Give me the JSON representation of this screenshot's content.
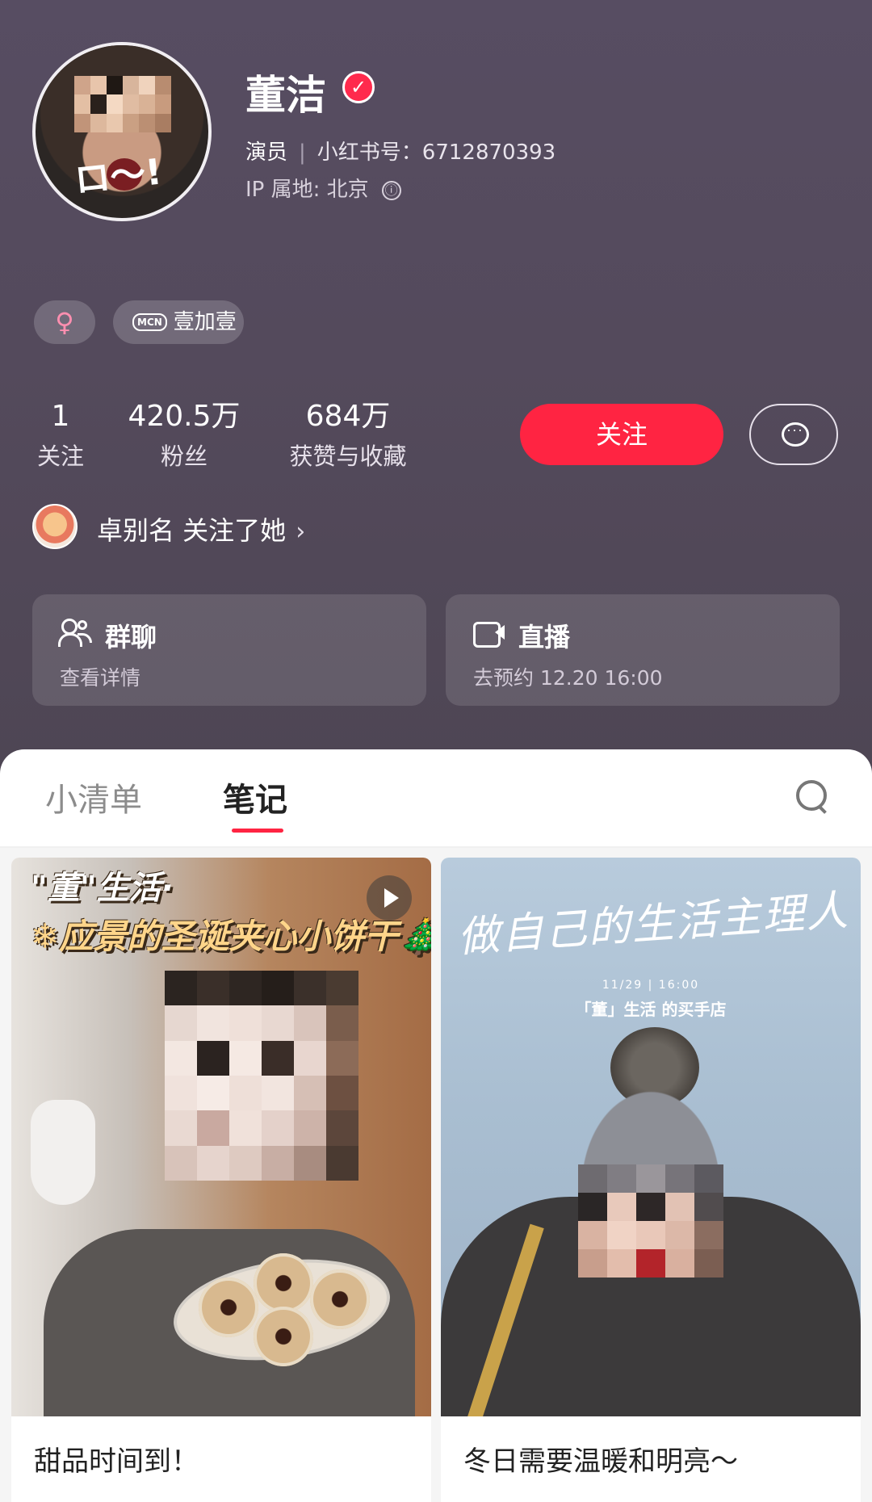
{
  "profile": {
    "name": "董洁",
    "verified_mark": "✓",
    "role": "演员",
    "separator": "|",
    "id_label": "小红书号：",
    "id_value": "6712870393",
    "ip_label": "IP 属地: 北京",
    "info_icon": "ⓘ",
    "gender_symbol": "♀",
    "mcn_badge": "MCN",
    "mcn_name": "壹加壹",
    "avatar_scribble": "ロ〜!"
  },
  "stats": [
    {
      "value": "1",
      "label": "关注"
    },
    {
      "value": "420.5万",
      "label": "粉丝"
    },
    {
      "value": "684万",
      "label": "获赞与收藏"
    }
  ],
  "actions": {
    "follow_label": "关注",
    "message_icon": "chat-bubble-icon"
  },
  "followed_by": {
    "text": "卓别名 关注了她",
    "chevron": "›"
  },
  "cards": [
    {
      "title": "群聊",
      "subtitle": "查看详情",
      "icon": "people-icon"
    },
    {
      "title": "直播",
      "subtitle": "去预约 12.20 16:00",
      "icon": "video-camera-icon"
    }
  ],
  "tabs": {
    "items": [
      "小清单",
      "笔记"
    ],
    "active": "笔记",
    "search_icon": "search-icon"
  },
  "posts": [
    {
      "cover_text_line1": "\"董\"生活·",
      "cover_text_line2": "❄应景的圣诞夹心小饼干🎄",
      "has_video": true,
      "title": "甜品时间到！"
    },
    {
      "cover_handwriting": "做自己的生活主理人",
      "cover_date": "11/29 | 16:00",
      "cover_shop": "「董」生活 的买手店",
      "title": "冬日需要温暖和明亮～"
    }
  ],
  "colors": {
    "accent": "#ff2442",
    "header_bg": "#544a5c"
  }
}
